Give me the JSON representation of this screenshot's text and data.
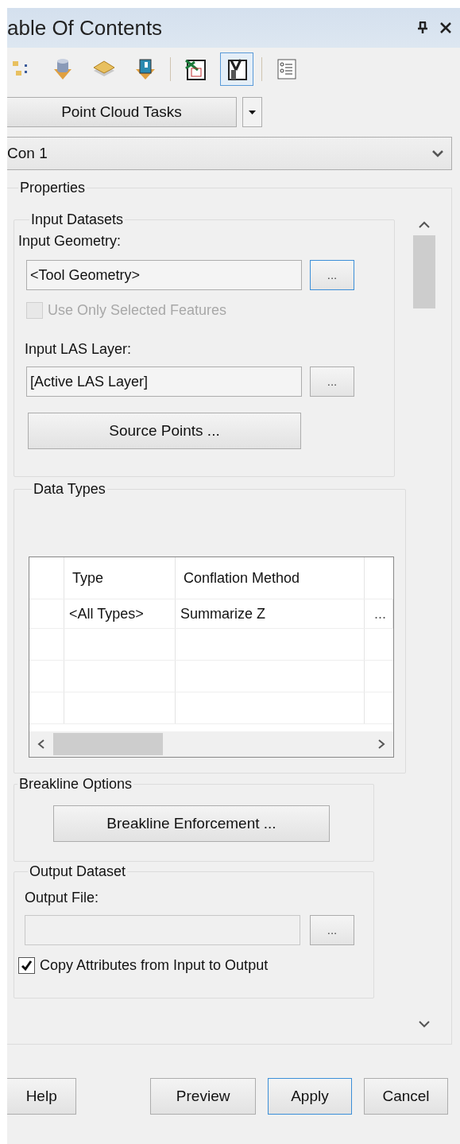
{
  "title": "able Of Contents",
  "toolbar": [
    {
      "selected": false
    },
    {
      "selected": false
    },
    {
      "selected": false
    },
    {
      "selected": false
    },
    {
      "selected": false
    },
    {
      "selected": true
    },
    {
      "selected": false
    }
  ],
  "task_button": "Point Cloud Tasks",
  "selector": {
    "value": "Con 1"
  },
  "properties": {
    "title": "Properties",
    "input_datasets": {
      "title": "Input Datasets",
      "geometry_label": "Input Geometry:",
      "geometry_value": "<Tool Geometry>",
      "geometry_browse": {
        "label": "...",
        "focused": true
      },
      "selected_only": {
        "label": "Use Only Selected Features",
        "checked": false,
        "disabled": true
      },
      "las_label": "Input LAS Layer:",
      "las_value": "[Active LAS Layer]",
      "las_browse": {
        "label": "...",
        "focused": false
      },
      "source_button": "Source Points ..."
    },
    "data_types": {
      "title": "Data Types",
      "columns": [
        "Type",
        "Conflation Method"
      ],
      "rows": [
        {
          "cells": [
            "<All Types>",
            "Summarize Z",
            "..."
          ]
        }
      ]
    },
    "breakline": {
      "title": "Breakline Options",
      "button": "Breakline Enforcement ..."
    },
    "output": {
      "title": "Output Dataset",
      "file_label": "Output File:",
      "file_disabled": true,
      "browse": "...",
      "copy": {
        "label": "Copy Attributes from Input to Output",
        "checked": true
      }
    }
  },
  "buttons": [
    {
      "kind": "help",
      "label": "Help",
      "focused": false
    },
    {
      "kind": "action",
      "label": "Preview",
      "focused": false
    },
    {
      "kind": "action",
      "label": "Apply",
      "focused": true
    },
    {
      "kind": "action",
      "label": "Cancel",
      "focused": false
    }
  ]
}
